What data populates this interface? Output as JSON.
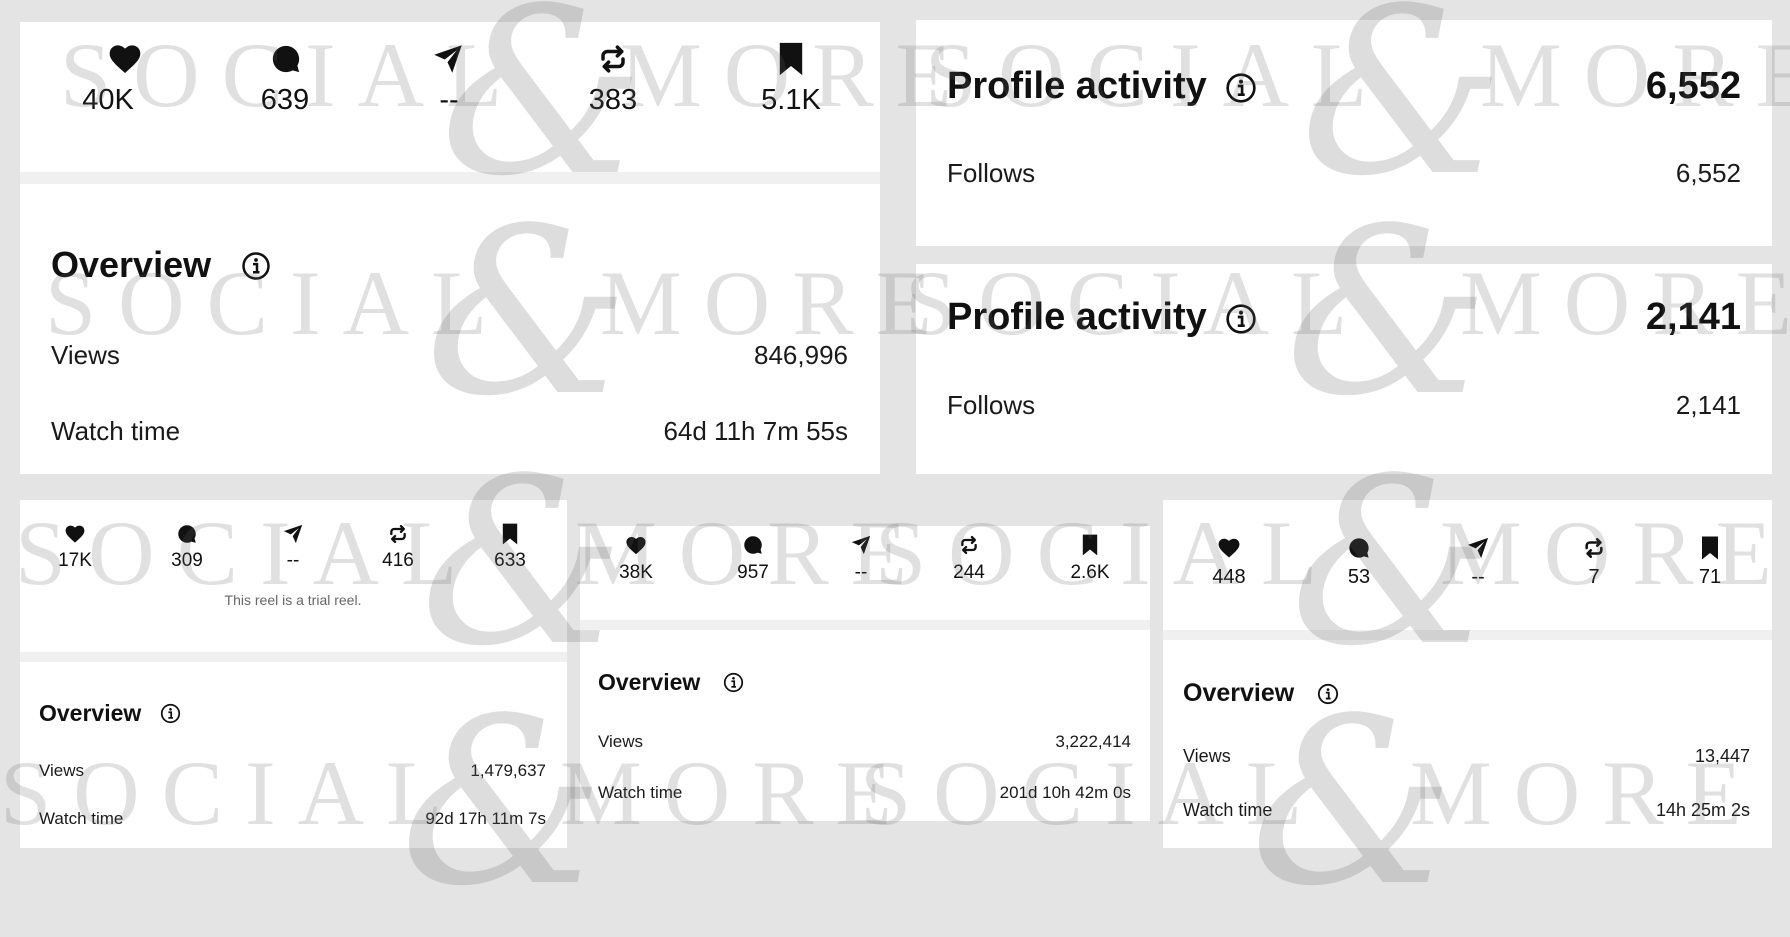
{
  "icons": {
    "likes": "heart-icon",
    "comments": "comment-icon",
    "shares": "send-icon",
    "reposts": "repost-icon",
    "saves": "bookmark-icon",
    "info": "info-icon"
  },
  "panel_a": {
    "stats": {
      "likes": "40K",
      "comments": "639",
      "shares": "--",
      "reposts": "383",
      "saves": "5.1K"
    },
    "overview": {
      "title": "Overview",
      "views_label": "Views",
      "views_value": "846,996",
      "watch_label": "Watch time",
      "watch_value": "64d 11h 7m 55s"
    }
  },
  "profile_1": {
    "title": "Profile activity",
    "total": "6,552",
    "follows_label": "Follows",
    "follows_value": "6,552"
  },
  "profile_2": {
    "title": "Profile activity",
    "total": "2,141",
    "follows_label": "Follows",
    "follows_value": "2,141"
  },
  "panel_b": {
    "stats": {
      "likes": "17K",
      "comments": "309",
      "shares": "--",
      "reposts": "416",
      "saves": "633"
    },
    "note": "This reel is a trial reel.",
    "overview": {
      "title": "Overview",
      "views_label": "Views",
      "views_value": "1,479,637",
      "watch_label": "Watch time",
      "watch_value": "92d 17h 11m 7s"
    }
  },
  "panel_c": {
    "stats": {
      "likes": "38K",
      "comments": "957",
      "shares": "--",
      "reposts": "244",
      "saves": "2.6K"
    },
    "overview": {
      "title": "Overview",
      "views_label": "Views",
      "views_value": "3,222,414",
      "watch_label": "Watch time",
      "watch_value": "201d 10h 42m 0s"
    }
  },
  "panel_d": {
    "stats": {
      "likes": "448",
      "comments": "53",
      "shares": "--",
      "reposts": "7",
      "saves": "71"
    },
    "overview": {
      "title": "Overview",
      "views_label": "Views",
      "views_value": "13,447",
      "watch_label": "Watch time",
      "watch_value": "14h 25m 2s"
    }
  },
  "watermark": {
    "word1": "SOCIAL",
    "mark": "&",
    "word2": "MORE"
  }
}
